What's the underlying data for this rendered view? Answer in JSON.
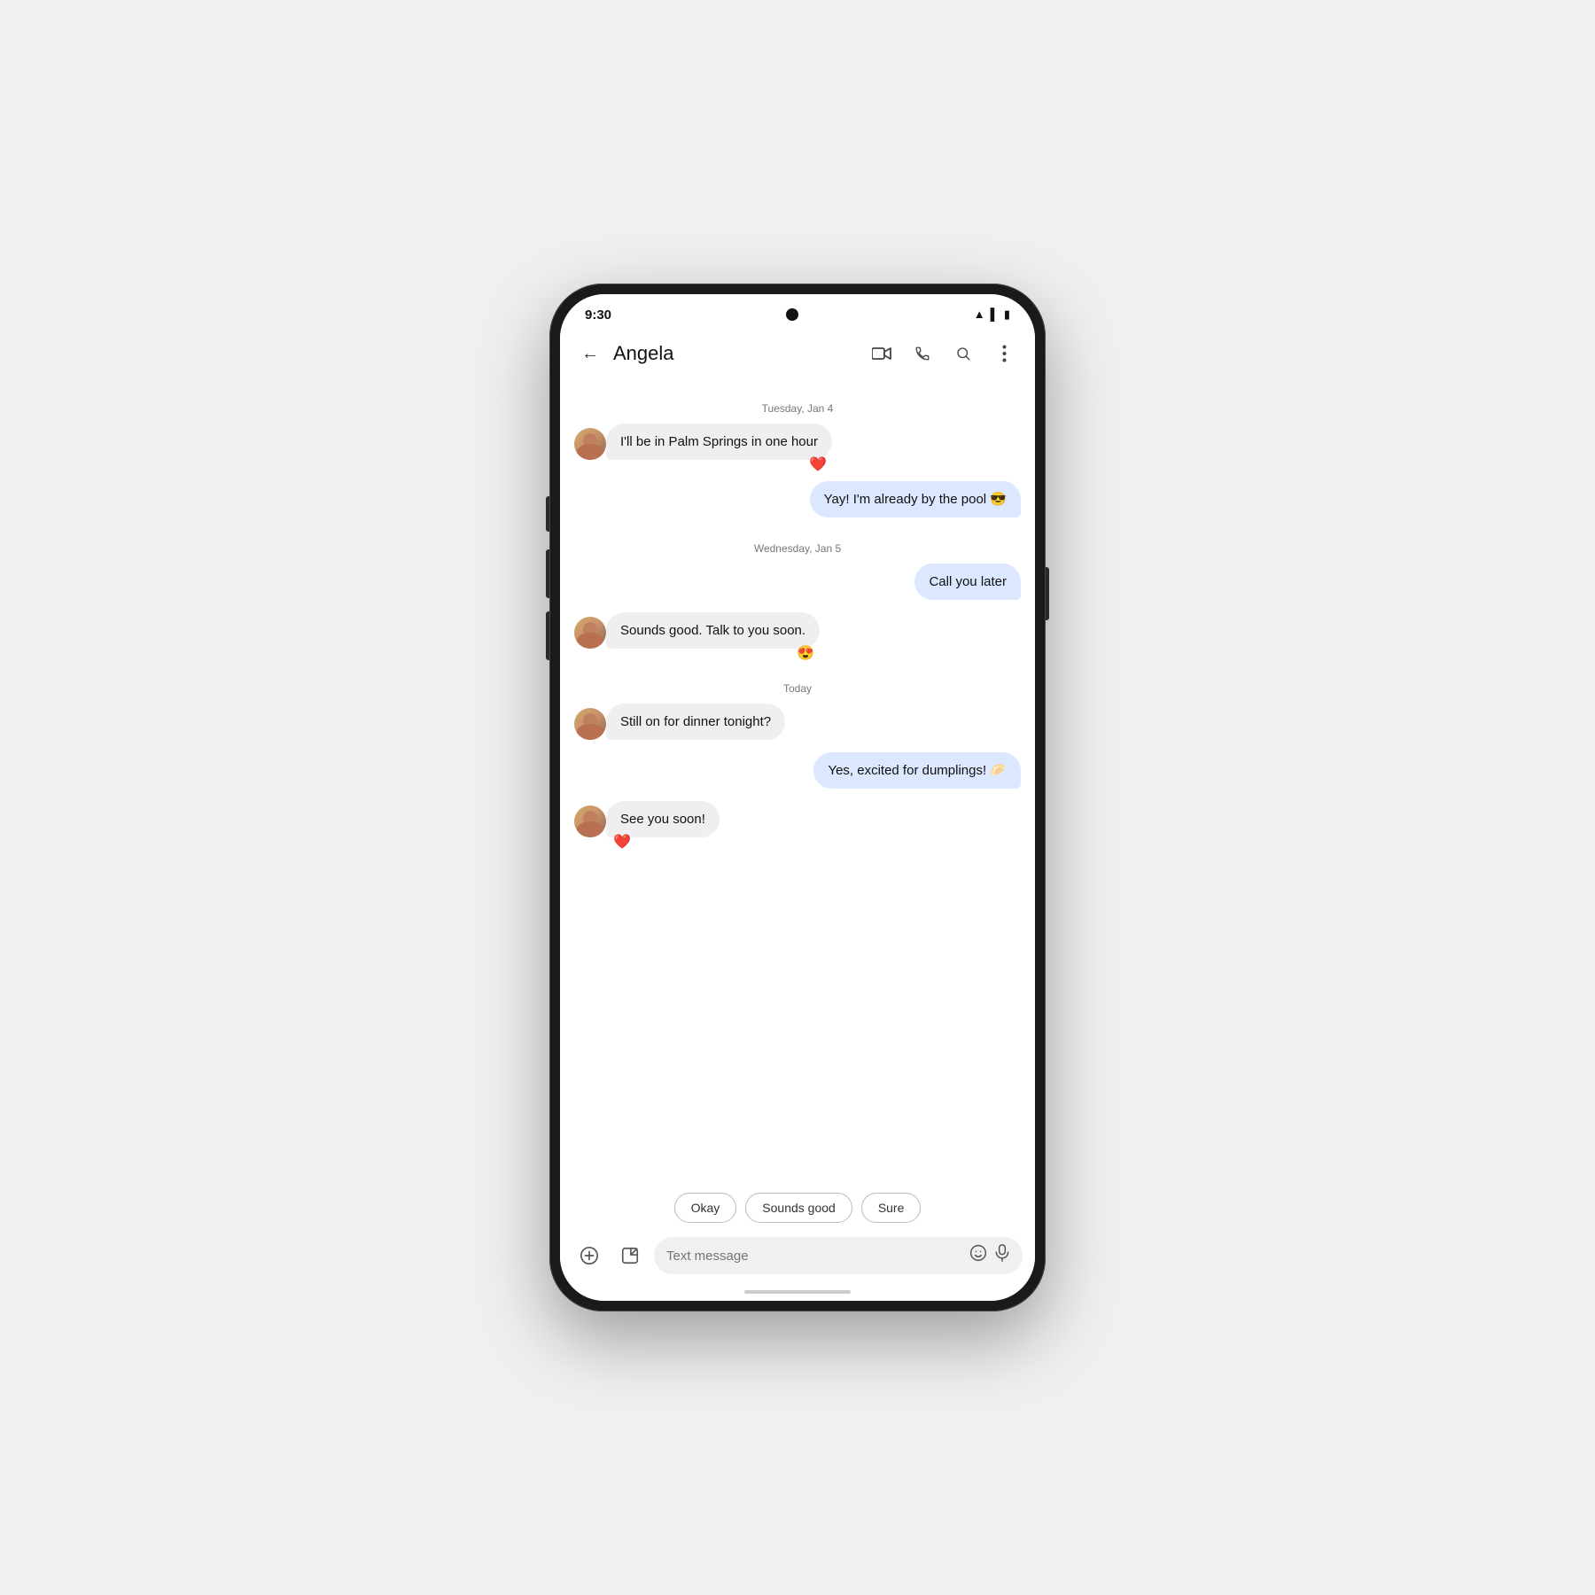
{
  "status_bar": {
    "time": "9:30"
  },
  "app_bar": {
    "contact_name": "Angela",
    "back_label": "←"
  },
  "messages": {
    "date1": "Tuesday, Jan 4",
    "date2": "Wednesday, Jan 5",
    "date3": "Today",
    "msg1": "I'll be in Palm Springs in one hour",
    "msg1_reaction": "❤️",
    "msg2": "Yay! I'm already by the pool 😎",
    "msg3": "Call you later",
    "msg4": "Sounds good. Talk to you soon.",
    "msg4_reaction": "😍",
    "msg5": "Still on for dinner tonight?",
    "msg6": "Yes, excited for dumplings! 🥟",
    "msg7": "See you soon!",
    "msg7_reaction": "❤️"
  },
  "quick_replies": {
    "btn1": "Okay",
    "btn2": "Sounds good",
    "btn3": "Sure"
  },
  "input_bar": {
    "placeholder": "Text message"
  },
  "icons": {
    "add": "+",
    "sticker": "🖼",
    "emoji": "😊",
    "mic": "🎤",
    "video": "📹",
    "phone": "📞",
    "search": "🔍",
    "more": "⋮"
  }
}
